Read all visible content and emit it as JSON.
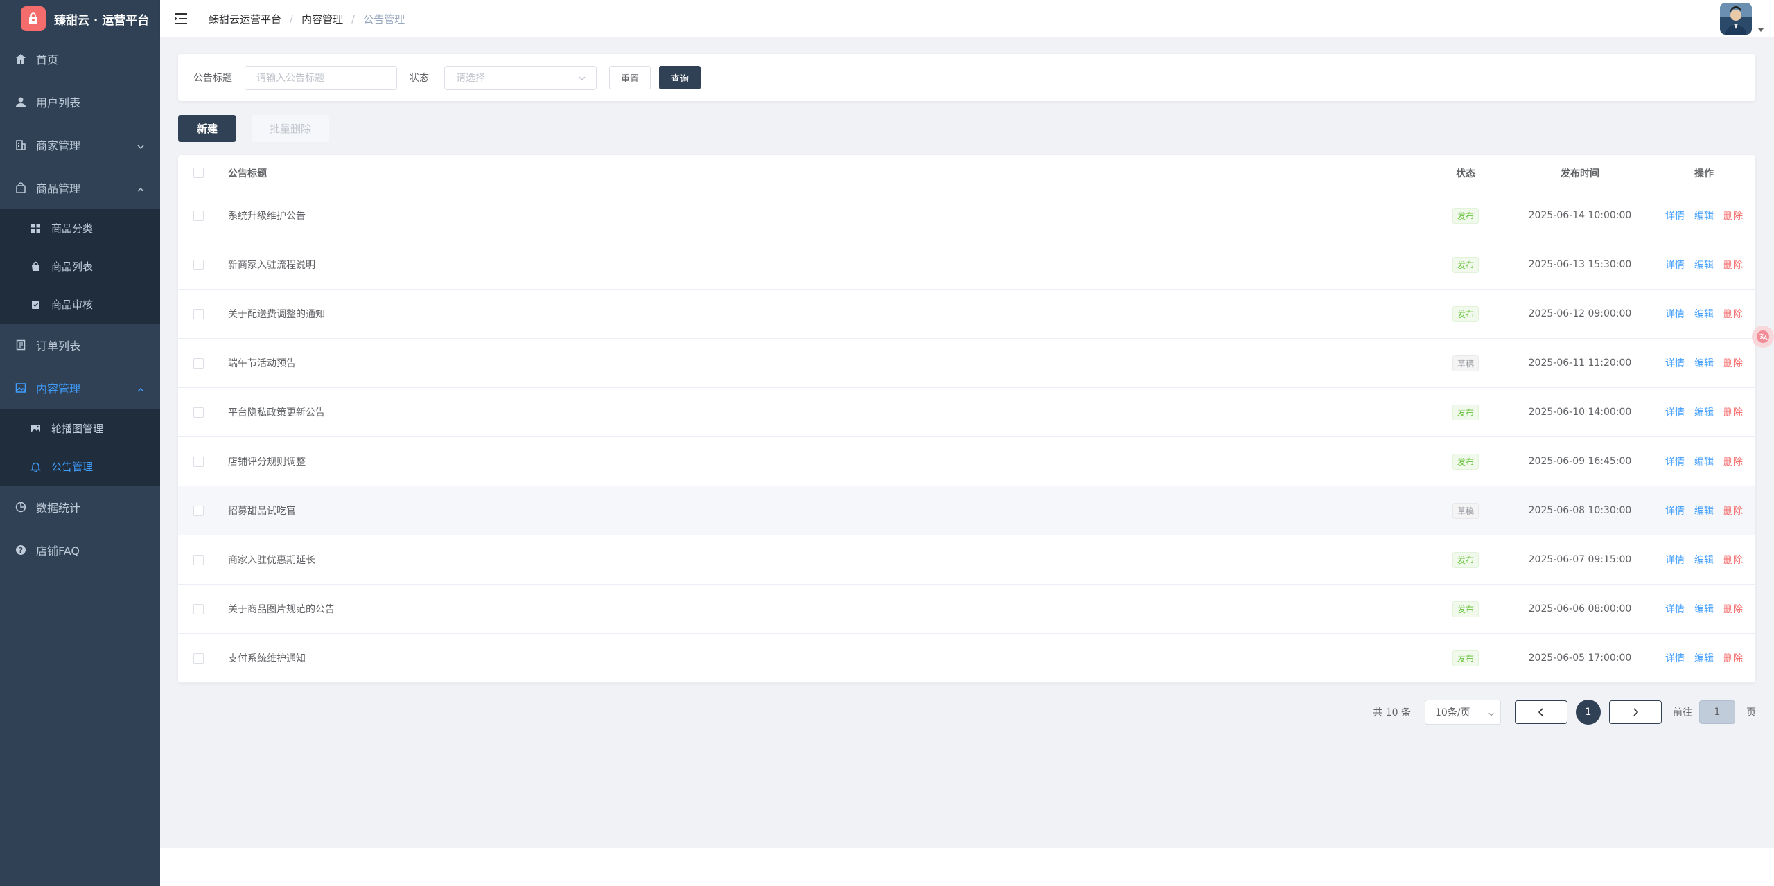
{
  "app": {
    "brand": "臻甜云 · 运营平台"
  },
  "sidebar": {
    "items": [
      {
        "label": "首页",
        "icon": "home-icon"
      },
      {
        "label": "用户列表",
        "icon": "user-icon"
      },
      {
        "label": "商家管理",
        "icon": "building-icon"
      },
      {
        "label": "商品管理",
        "icon": "bag-icon"
      },
      {
        "label": "订单列表",
        "icon": "document-icon"
      },
      {
        "label": "内容管理",
        "icon": "image-icon"
      },
      {
        "label": "数据统计",
        "icon": "pie-chart-icon"
      },
      {
        "label": "店铺FAQ",
        "icon": "question-icon"
      }
    ],
    "goods_sub": [
      {
        "label": "商品分类",
        "icon": "grid-icon"
      },
      {
        "label": "商品列表",
        "icon": "shopping-bag-icon"
      },
      {
        "label": "商品审核",
        "icon": "clipboard-check-icon"
      }
    ],
    "content_sub": [
      {
        "label": "轮播图管理",
        "icon": "picture-icon"
      },
      {
        "label": "公告管理",
        "icon": "bell-icon"
      }
    ],
    "active_color": "#409eff"
  },
  "breadcrumb": [
    "臻甜云运营平台",
    "内容管理",
    "公告管理"
  ],
  "search": {
    "title_label": "公告标题",
    "title_placeholder": "请输入公告标题",
    "status_label": "状态",
    "status_placeholder": "请选择",
    "reset_label": "重置",
    "query_label": "查询"
  },
  "actions": {
    "new_label": "新建",
    "batch_delete_label": "批量删除"
  },
  "table": {
    "headers": {
      "title": "公告标题",
      "status": "状态",
      "time": "发布时间",
      "ops": "操作"
    },
    "op_labels": {
      "detail": "详情",
      "edit": "编辑",
      "delete": "删除"
    },
    "rows": [
      {
        "title": "系统升级维护公告",
        "status": "发布",
        "time": "2025-06-14 10:00:00"
      },
      {
        "title": "新商家入驻流程说明",
        "status": "发布",
        "time": "2025-06-13 15:30:00"
      },
      {
        "title": "关于配送费调整的通知",
        "status": "发布",
        "time": "2025-06-12 09:00:00"
      },
      {
        "title": "端午节活动预告",
        "status": "草稿",
        "time": "2025-06-11 11:20:00"
      },
      {
        "title": "平台隐私政策更新公告",
        "status": "发布",
        "time": "2025-06-10 14:00:00"
      },
      {
        "title": "店铺评分规则调整",
        "status": "发布",
        "time": "2025-06-09 16:45:00"
      },
      {
        "title": "招募甜品试吃官",
        "status": "草稿",
        "time": "2025-06-08 10:30:00"
      },
      {
        "title": "商家入驻优惠期延长",
        "status": "发布",
        "time": "2025-06-07 09:15:00"
      },
      {
        "title": "关于商品图片规范的公告",
        "status": "发布",
        "time": "2025-06-06 08:00:00"
      },
      {
        "title": "支付系统维护通知",
        "status": "发布",
        "time": "2025-06-05 17:00:00"
      }
    ]
  },
  "status_colors": {
    "发布": {
      "text": "#67c23a",
      "bg": "#f0f9eb",
      "border": "#e1f3d8"
    },
    "草稿": {
      "text": "#909399",
      "bg": "#f4f4f5",
      "border": "#e9e9eb"
    }
  },
  "pagination": {
    "total_text": "共 10 条",
    "page_size": "10条/页",
    "current_page": "1",
    "goto_label": "前往",
    "goto_value": "1",
    "page_unit": "页"
  }
}
